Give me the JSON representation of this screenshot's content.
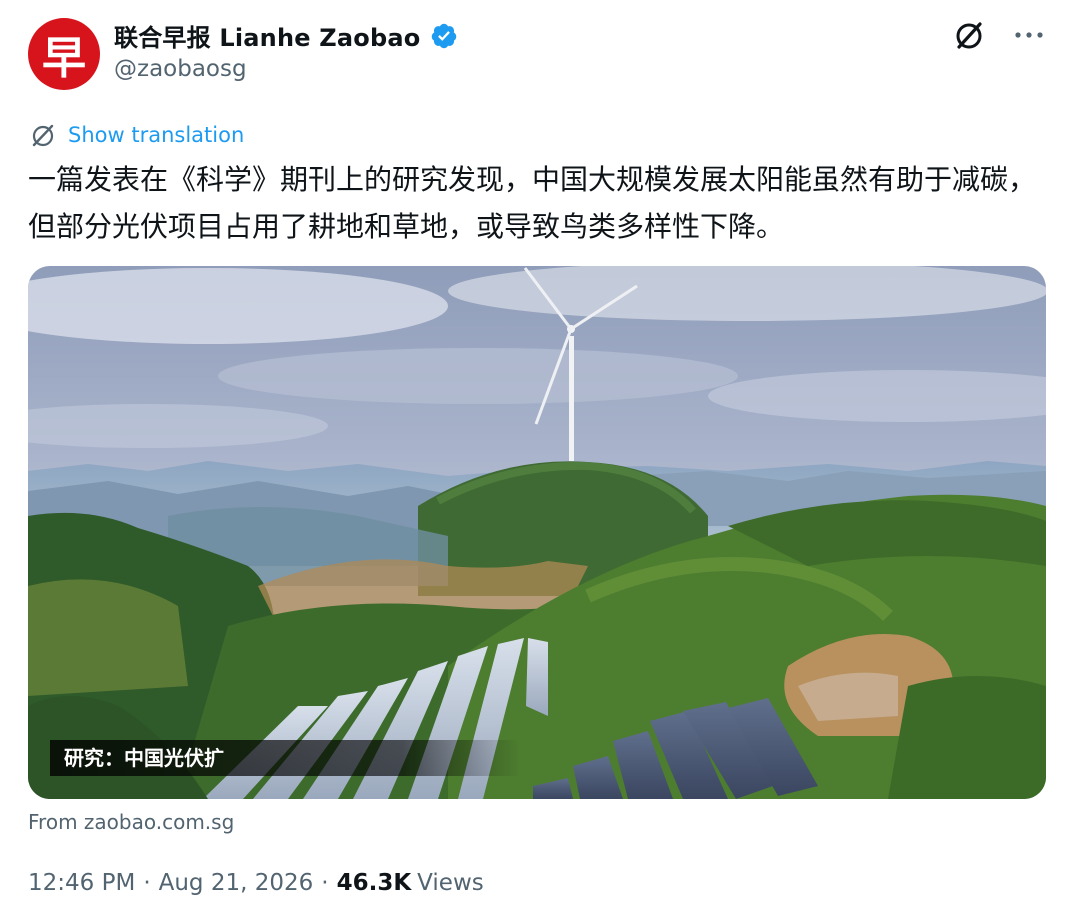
{
  "author": {
    "avatar_glyph": "早",
    "display_name": "联合早报 Lianhe Zaobao",
    "handle": "@zaobaosg",
    "verified": true
  },
  "actions": {
    "grok_icon": "slashed-circle-icon",
    "more_icon": "more-icon"
  },
  "translation": {
    "label": "Show translation"
  },
  "tweet": {
    "text": "一篇发表在《科学》期刊上的研究发现，中国大规模发展太阳能虽然有助于减碳，但部分光伏项目占用了耕地和草地，或导致鸟类多样性下降。"
  },
  "media": {
    "caption": "研究：中国光伏扩"
  },
  "source": {
    "text": "From zaobao.com.sg"
  },
  "meta": {
    "time": "12:46 PM",
    "date": "Aug 21, 2026",
    "views_count": "46.3K",
    "views_label": "Views"
  },
  "colors": {
    "accent": "#1d9bf0",
    "brand_red": "#d7141c",
    "text": "#0f1419",
    "muted": "#536471"
  }
}
